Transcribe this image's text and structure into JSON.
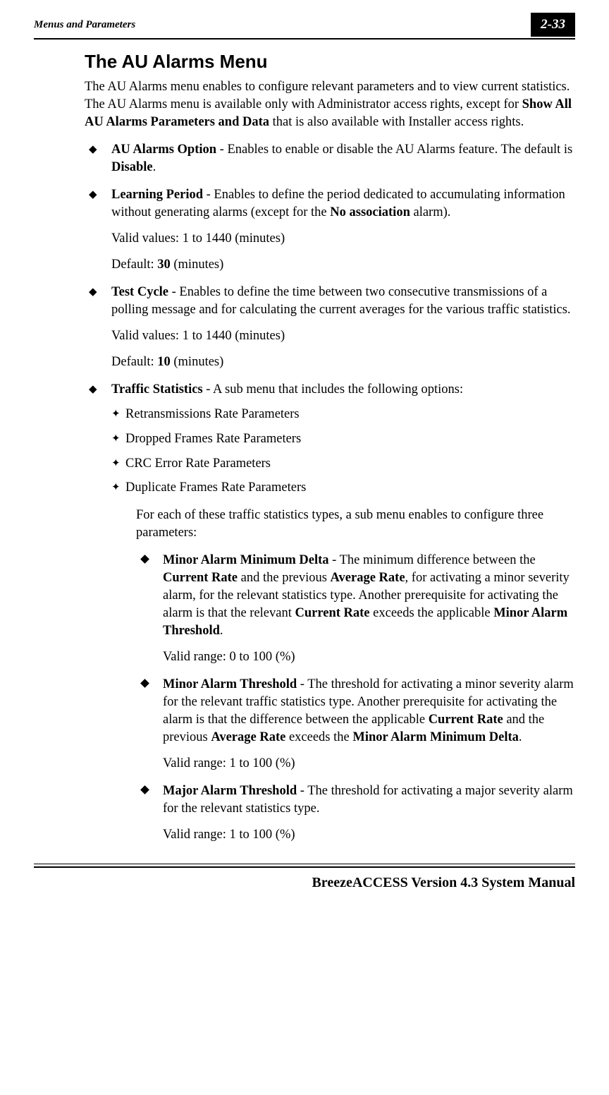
{
  "header": {
    "left": "Menus and Parameters",
    "right": "2-33"
  },
  "title": "The AU Alarms Menu",
  "intro": {
    "p1a": "The AU Alarms menu enables to configure relevant parameters and to view current statistics. The AU Alarms menu is available only with Administrator access rights, except for ",
    "p1b": "Show All AU Alarms Parameters and Data",
    "p1c": " that is also available with Installer access rights."
  },
  "items": {
    "au_option": {
      "label": "AU Alarms Option",
      "text_a": " - Enables to enable or disable the AU Alarms feature. The default is ",
      "text_b": "Disable",
      "text_c": "."
    },
    "learning": {
      "label": "Learning Period",
      "text_a": " - Enables to define the period dedicated to accumulating information without generating alarms (except for the ",
      "text_b": "No association",
      "text_c": " alarm).",
      "valid": "Valid values: 1 to 1440 (minutes)",
      "default_a": "Default: ",
      "default_b": "30",
      "default_c": " (minutes)"
    },
    "test_cycle": {
      "label": "Test Cycle",
      "text": " - Enables to define the time between two consecutive transmissions of a polling message and for calculating the current averages for the various traffic statistics.",
      "valid": "Valid values: 1 to 1440 (minutes)",
      "default_a": "Default: ",
      "default_b": "10",
      "default_c": " (minutes)"
    },
    "traffic": {
      "label": "Traffic Statistics",
      "text": " - A sub menu that includes the following options:",
      "sub": [
        "Retransmissions Rate Parameters",
        "Dropped Frames Rate Parameters",
        "CRC Error Rate Parameters",
        "Duplicate Frames Rate Parameters"
      ],
      "sub_intro": "For each of these traffic statistics types, a sub menu enables to configure three parameters:",
      "params": {
        "minor_delta": {
          "label": "Minor Alarm Minimum Delta",
          "t1": " - The minimum difference between the ",
          "t2": "Current Rate",
          "t3": " and the previous ",
          "t4": "Average Rate",
          "t5": ", for activating a minor severity alarm, for the relevant statistics type. Another prerequisite for activating the alarm is that the relevant ",
          "t6": "Current Rate",
          "t7": " exceeds the applicable ",
          "t8": "Minor Alarm Threshold",
          "t9": ".",
          "valid": "Valid range: 0 to 100 (%)"
        },
        "minor_thresh": {
          "label": "Minor Alarm Threshold",
          "t1": " - The threshold for activating a minor severity alarm for the relevant traffic statistics type. Another prerequisite for activating the alarm is that the difference between the applicable ",
          "t2": "Current Rate",
          "t3": " and the previous ",
          "t4": "Average Rate",
          "t5": " exceeds the ",
          "t6": "Minor Alarm Minimum Delta",
          "t7": ".",
          "valid": "Valid range: 1 to 100 (%)"
        },
        "major_thresh": {
          "label": "Major Alarm Threshold",
          "t1": " - The threshold for activating a major severity alarm for the relevant statistics type.",
          "valid": "Valid range: 1 to 100 (%)"
        }
      }
    }
  },
  "footer": "BreezeACCESS Version 4.3 System Manual"
}
